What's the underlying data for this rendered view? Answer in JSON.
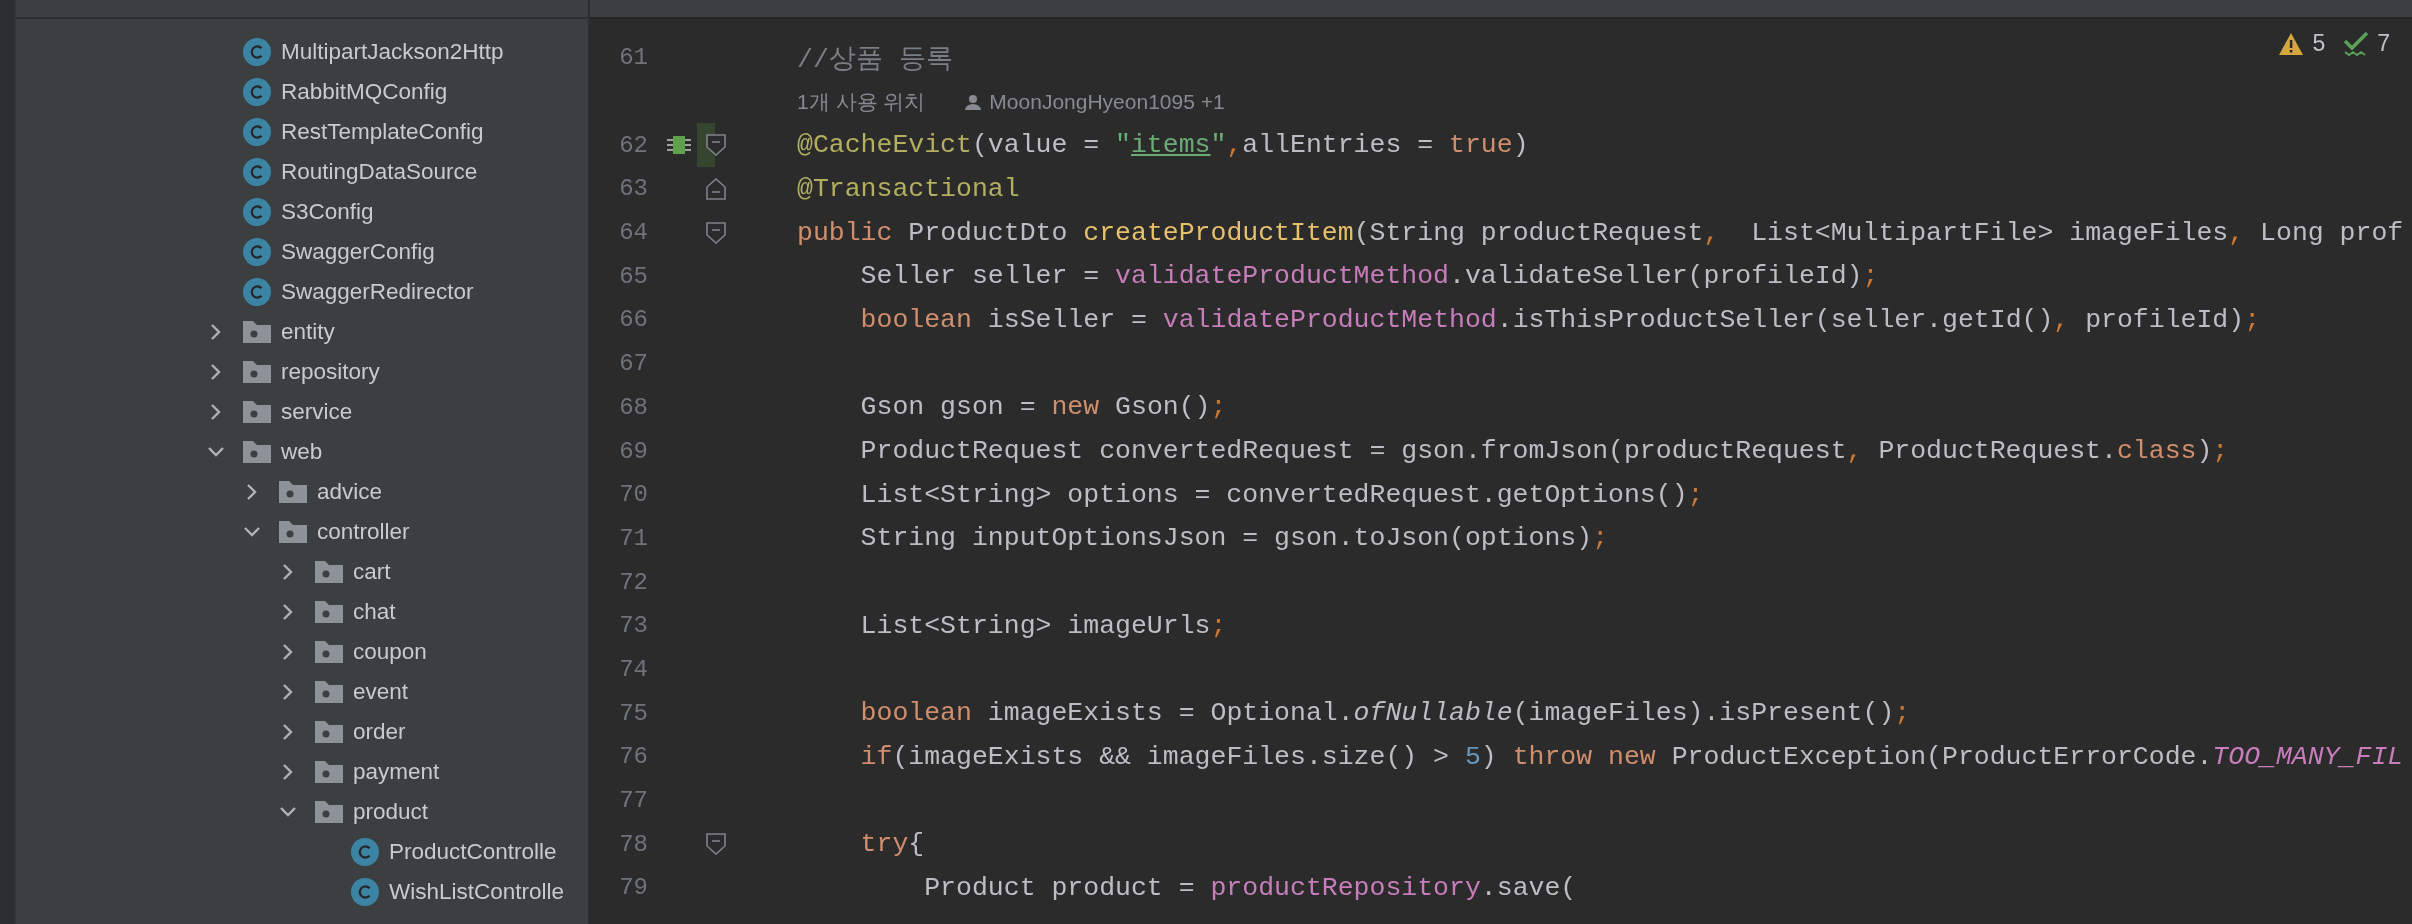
{
  "project_tree": {
    "files_of_scrolled_folder": [
      {
        "kind": "class",
        "label": "MultipartJackson2Http"
      },
      {
        "kind": "class",
        "label": "RabbitMQConfig"
      },
      {
        "kind": "class",
        "label": "RestTemplateConfig"
      },
      {
        "kind": "class",
        "label": "RoutingDataSource"
      },
      {
        "kind": "class",
        "label": "S3Config"
      },
      {
        "kind": "class",
        "label": "SwaggerConfig"
      },
      {
        "kind": "class",
        "label": "SwaggerRedirector"
      }
    ],
    "items": [
      {
        "kind": "folder",
        "label": "entity",
        "expanded": false
      },
      {
        "kind": "folder",
        "label": "repository",
        "expanded": false
      },
      {
        "kind": "folder",
        "label": "service",
        "expanded": false
      },
      {
        "kind": "folder",
        "label": "web",
        "expanded": true,
        "children": [
          {
            "kind": "folder",
            "label": "advice",
            "expanded": false
          },
          {
            "kind": "folder",
            "label": "controller",
            "expanded": true,
            "children": [
              {
                "kind": "folder",
                "label": "cart",
                "expanded": false
              },
              {
                "kind": "folder",
                "label": "chat",
                "expanded": false
              },
              {
                "kind": "folder",
                "label": "coupon",
                "expanded": false
              },
              {
                "kind": "folder",
                "label": "event",
                "expanded": false
              },
              {
                "kind": "folder",
                "label": "order",
                "expanded": false
              },
              {
                "kind": "folder",
                "label": "payment",
                "expanded": false
              },
              {
                "kind": "folder",
                "label": "product",
                "expanded": true,
                "children": [
                  {
                    "kind": "class",
                    "label": "ProductControlle"
                  },
                  {
                    "kind": "class",
                    "label": "WishListControlle"
                  }
                ]
              }
            ]
          }
        ]
      }
    ]
  },
  "editor": {
    "inspections": [
      {
        "kind": "warning",
        "count": "5"
      },
      {
        "kind": "weak-warning",
        "count": "7"
      }
    ],
    "lines": [
      {
        "kind": "code",
        "number": "61",
        "tokens": [
          {
            "kind": "comment",
            "text": "//상품 등록"
          }
        ]
      },
      {
        "kind": "hint",
        "usages": "1개 사용 위치",
        "author": "MoonJongHyeon1095 +1"
      },
      {
        "kind": "code",
        "number": "62",
        "changed": true,
        "bean_marker": true,
        "fold_start": true,
        "tokens": [
          {
            "kind": "annotation",
            "text": "@CacheEvict"
          },
          {
            "kind": "plain",
            "text": "(value = "
          },
          {
            "kind": "string",
            "text": "\""
          },
          {
            "kind": "link",
            "text": "items"
          },
          {
            "kind": "string",
            "text": "\""
          },
          {
            "kind": "punct",
            "text": ","
          },
          {
            "kind": "plain",
            "text": "allEntries = "
          },
          {
            "kind": "keyword",
            "text": "true"
          },
          {
            "kind": "plain",
            "text": ")"
          }
        ]
      },
      {
        "kind": "code",
        "number": "63",
        "fold_end": true,
        "tokens": [
          {
            "kind": "annotation",
            "text": "@Transactional"
          }
        ]
      },
      {
        "kind": "code",
        "number": "64",
        "fold_start": true,
        "tokens": [
          {
            "kind": "keyword",
            "text": "public"
          },
          {
            "kind": "plain",
            "text": " ProductDto "
          },
          {
            "kind": "method",
            "text": "createProductItem"
          },
          {
            "kind": "plain",
            "text": "(String productRequest"
          },
          {
            "kind": "punct",
            "text": ","
          },
          {
            "kind": "plain",
            "text": "  List<MultipartFile> imageFiles"
          },
          {
            "kind": "punct",
            "text": ","
          },
          {
            "kind": "plain",
            "text": " Long prof"
          }
        ]
      },
      {
        "kind": "code",
        "number": "65",
        "tokens": [
          {
            "kind": "plain",
            "text": "    Seller seller = "
          },
          {
            "kind": "field",
            "text": "validateProductMethod"
          },
          {
            "kind": "plain",
            "text": ".validateSeller(profileId)"
          },
          {
            "kind": "punct",
            "text": ";"
          }
        ]
      },
      {
        "kind": "code",
        "number": "66",
        "tokens": [
          {
            "kind": "keyword",
            "text": "    boolean"
          },
          {
            "kind": "plain",
            "text": " isSeller = "
          },
          {
            "kind": "field",
            "text": "validateProductMethod"
          },
          {
            "kind": "plain",
            "text": ".isThisProductSeller(seller.getId()"
          },
          {
            "kind": "punct",
            "text": ","
          },
          {
            "kind": "plain",
            "text": " profileId)"
          },
          {
            "kind": "punct",
            "text": ";"
          }
        ]
      },
      {
        "kind": "code",
        "number": "67"
      },
      {
        "kind": "code",
        "number": "68",
        "tokens": [
          {
            "kind": "plain",
            "text": "    Gson gson = "
          },
          {
            "kind": "keyword",
            "text": "new"
          },
          {
            "kind": "plain",
            "text": " Gson()"
          },
          {
            "kind": "punct",
            "text": ";"
          }
        ]
      },
      {
        "kind": "code",
        "number": "69",
        "tokens": [
          {
            "kind": "plain",
            "text": "    ProductRequest convertedRequest = gson.fromJson(productRequest"
          },
          {
            "kind": "punct",
            "text": ","
          },
          {
            "kind": "plain",
            "text": " ProductRequest."
          },
          {
            "kind": "keyword",
            "text": "class"
          },
          {
            "kind": "plain",
            "text": ")"
          },
          {
            "kind": "punct",
            "text": ";"
          }
        ]
      },
      {
        "kind": "code",
        "number": "70",
        "tokens": [
          {
            "kind": "plain",
            "text": "    List<String> options = convertedRequest.getOptions()"
          },
          {
            "kind": "punct",
            "text": ";"
          }
        ]
      },
      {
        "kind": "code",
        "number": "71",
        "tokens": [
          {
            "kind": "plain",
            "text": "    String inputOptionsJson = gson.toJson(options)"
          },
          {
            "kind": "punct",
            "text": ";"
          }
        ]
      },
      {
        "kind": "code",
        "number": "72"
      },
      {
        "kind": "code",
        "number": "73",
        "tokens": [
          {
            "kind": "plain",
            "text": "    List<String> imageUrls"
          },
          {
            "kind": "punct",
            "text": ";"
          }
        ]
      },
      {
        "kind": "code",
        "number": "74"
      },
      {
        "kind": "code",
        "number": "75",
        "tokens": [
          {
            "kind": "keyword",
            "text": "    boolean"
          },
          {
            "kind": "plain",
            "text": " imageExists = Optional."
          },
          {
            "kind": "static-method",
            "text": "ofNullable"
          },
          {
            "kind": "plain",
            "text": "(imageFiles).isPresent()"
          },
          {
            "kind": "punct",
            "text": ";"
          }
        ]
      },
      {
        "kind": "code",
        "number": "76",
        "tokens": [
          {
            "kind": "keyword",
            "text": "    if"
          },
          {
            "kind": "plain",
            "text": "(imageExists && imageFiles.size() > "
          },
          {
            "kind": "number",
            "text": "5"
          },
          {
            "kind": "plain",
            "text": ") "
          },
          {
            "kind": "keyword",
            "text": "throw new"
          },
          {
            "kind": "plain",
            "text": " ProductException(ProductErrorCode."
          },
          {
            "kind": "constant",
            "text": "TOO_MANY_FIL"
          }
        ]
      },
      {
        "kind": "code",
        "number": "77"
      },
      {
        "kind": "code",
        "number": "78",
        "fold_start": true,
        "tokens": [
          {
            "kind": "keyword",
            "text": "    try"
          },
          {
            "kind": "plain",
            "text": "{"
          }
        ]
      },
      {
        "kind": "code",
        "number": "79",
        "tokens": [
          {
            "kind": "plain",
            "text": "        Product product = "
          },
          {
            "kind": "field",
            "text": "productRepository"
          },
          {
            "kind": "plain",
            "text": ".save("
          }
        ]
      }
    ]
  }
}
